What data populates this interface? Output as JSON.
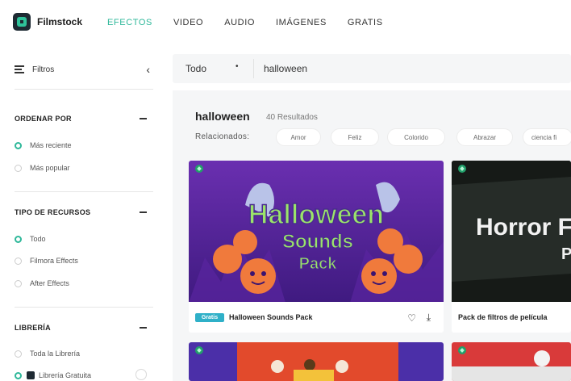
{
  "brand": {
    "name": "Filmstock"
  },
  "nav": [
    "EFECTOS",
    "VIDEO",
    "AUDIO",
    "IMÁGENES",
    "GRATIS"
  ],
  "nav_active_color": "#2fb89a",
  "sidebar": {
    "filters_label": "Filtros",
    "sections": [
      {
        "title": "ORDENAR POR",
        "options": [
          {
            "label": "Más reciente",
            "checked": true
          },
          {
            "label": "Más popular",
            "checked": false
          }
        ]
      },
      {
        "title": "TIPO DE RECURSOS",
        "options": [
          {
            "label": "Todo",
            "checked": true
          },
          {
            "label": "Filmora Effects",
            "checked": false
          },
          {
            "label": "After Effects",
            "checked": false
          }
        ]
      },
      {
        "title": "LIBRERÍA",
        "options": [
          {
            "label": "Toda la Librería",
            "checked": false
          },
          {
            "label": "Librería Gratuita",
            "checked": true
          }
        ]
      }
    ]
  },
  "search": {
    "scope": "Todo",
    "query": "halloween"
  },
  "results": {
    "query": "halloween",
    "count_text": "40 Resultados",
    "related_label": "Relacionados:",
    "related_tags": [
      "Amor",
      "Feliz",
      "Colorido",
      "Abrazar",
      "ciencia fi"
    ]
  },
  "cards": [
    {
      "title": "Halloween Sounds Pack",
      "badge": "Gratis",
      "thumb_text": [
        "Halloween",
        "Sounds",
        "Pack"
      ]
    },
    {
      "title": "Pack de filtros de película",
      "badge": "",
      "thumb_text": [
        "Horror F",
        "P"
      ]
    }
  ]
}
